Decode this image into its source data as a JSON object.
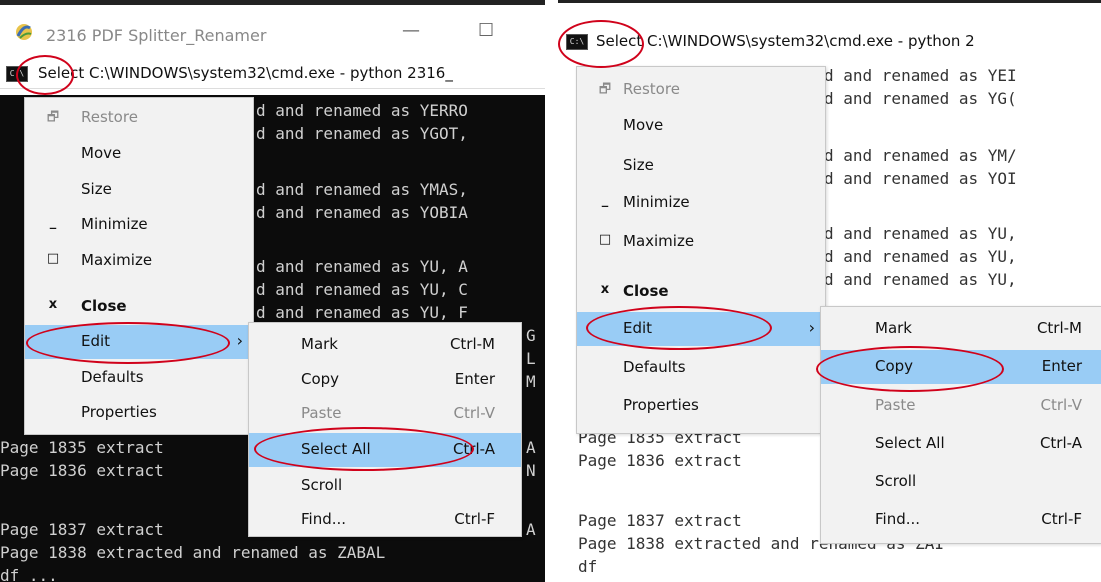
{
  "left": {
    "window_title": "2316 PDF Splitter_Renamer",
    "minimize_glyph": "—",
    "maximize_glyph": "☐",
    "cmd_title": "Select C:\\WINDOWS\\system32\\cmd.exe - python  2316_",
    "console_lines": [
      "d and renamed as YERRO",
      "d and renamed as YGOT,",
      "",
      "d and renamed as YMAS,",
      "d and renamed as YOBIA",
      "",
      "d and renamed as YU, A",
      "d and renamed as YU, C",
      "d and renamed as YU, F"
    ],
    "console_lines_right_fragments": [
      "G",
      "L",
      "M",
      "A",
      "N",
      "A",
      "A"
    ],
    "console_lines_bottom": [
      "Page 1835 extract",
      "Page 1836 extract",
      "",
      "Page 1837 extract",
      "Page 1838 extracted and renamed as ZABAL",
      "df ..."
    ],
    "system_menu": [
      {
        "label": "Restore",
        "glyph": "🗗",
        "disabled": true
      },
      {
        "label": "Move",
        "glyph": ""
      },
      {
        "label": "Size",
        "glyph": ""
      },
      {
        "label": "Minimize",
        "glyph": "_"
      },
      {
        "label": "Maximize",
        "glyph": "□"
      },
      {
        "label": "Close",
        "glyph": "x",
        "bold": true
      },
      {
        "label": "Edit",
        "glyph": "",
        "highlight": true,
        "arrow": "›"
      },
      {
        "label": "Defaults",
        "glyph": ""
      },
      {
        "label": "Properties",
        "glyph": ""
      }
    ],
    "edit_submenu": [
      {
        "label": "Mark",
        "shortcut": "Ctrl-M"
      },
      {
        "label": "Copy",
        "shortcut": "Enter"
      },
      {
        "label": "Paste",
        "shortcut": "Ctrl-V",
        "disabled": true
      },
      {
        "label": "Select All",
        "shortcut": "Ctrl-A",
        "highlight": true
      },
      {
        "label": "Scroll",
        "shortcut": ""
      },
      {
        "label": "Find...",
        "shortcut": "Ctrl-F"
      }
    ]
  },
  "right": {
    "cmd_title": "Select C:\\WINDOWS\\system32\\cmd.exe - python  2",
    "console_lines": [
      "d and renamed as YEI",
      "d and renamed as YG(",
      "",
      "d and renamed as YM/",
      "d and renamed as YOI",
      "",
      "d and renamed as YU,",
      "d and renamed as YU,",
      "d and renamed as YU,"
    ],
    "console_lines_bottom": [
      "Page 1835 extract",
      "Page 1836 extract",
      "",
      "Page 1837 extract",
      "Page 1838 extracted and renamed as ZAI",
      "df"
    ],
    "system_menu": [
      {
        "label": "Restore",
        "glyph": "🗗",
        "disabled": true
      },
      {
        "label": "Move",
        "glyph": ""
      },
      {
        "label": "Size",
        "glyph": ""
      },
      {
        "label": "Minimize",
        "glyph": "_"
      },
      {
        "label": "Maximize",
        "glyph": "□"
      },
      {
        "label": "Close",
        "glyph": "x",
        "bold": true
      },
      {
        "label": "Edit",
        "glyph": "",
        "highlight": true,
        "arrow": "›"
      },
      {
        "label": "Defaults",
        "glyph": ""
      },
      {
        "label": "Properties",
        "glyph": ""
      }
    ],
    "edit_submenu": [
      {
        "label": "Mark",
        "shortcut": "Ctrl-M"
      },
      {
        "label": "Copy",
        "shortcut": "Enter",
        "highlight": true
      },
      {
        "label": "Paste",
        "shortcut": "Ctrl-V",
        "disabled": true
      },
      {
        "label": "Select All",
        "shortcut": "Ctrl-A"
      },
      {
        "label": "Scroll",
        "shortcut": ""
      },
      {
        "label": "Find...",
        "shortcut": "Ctrl-F"
      }
    ]
  },
  "colors": {
    "highlight": "#99ccf5",
    "annotation_ring": "#d0021b",
    "console_dark_bg": "#0c0c0c",
    "menu_bg": "#f2f2f2"
  },
  "icons": {
    "app_icon": "python-feather-icon",
    "console_icon": "cmd-icon",
    "submenu_arrow": "chevron-right-icon"
  }
}
